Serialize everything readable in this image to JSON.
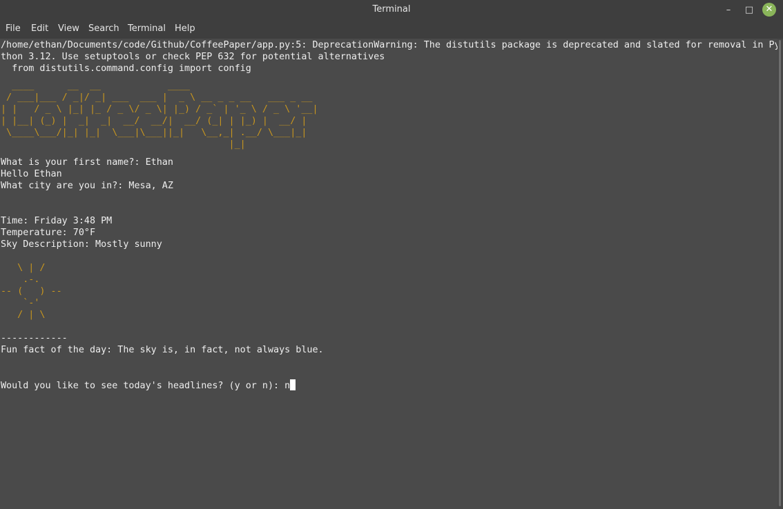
{
  "window": {
    "title": "Terminal",
    "controls": {
      "minimize": "–",
      "maximize": "□",
      "close": "✕"
    }
  },
  "menu": [
    "File",
    "Edit",
    "View",
    "Search",
    "Terminal",
    "Help"
  ],
  "terminal": {
    "warning": [
      "/home/ethan/Documents/code/Github/CoffeePaper/app.py:5: DeprecationWarning: The distutils package is deprecated and slated for removal in Py",
      "thon 3.12. Use setuptools or check PEP 632 for potential alternatives",
      "  from distutils.command.config import config"
    ],
    "banner_art": [
      "  ____      __  __            ____",
      " / ___|___ / _|/ _| ___  ___ |  _ \\ __ _ _ __   ___ _ __",
      "| |   / _ \\ |_| |_ / _ \\/ _ \\| |_) / _` | '_ \\ / _ \\ '__|",
      "| |__| (_) |  _|  _|  __/  __/|  __/ (_| | |_) |  __/ |",
      " \\____\\___/|_| |_|  \\___|\\___||_|   \\__,_| .__/ \\___|_|",
      "                                         |_|"
    ],
    "name_prompt": "What is your first name?: Ethan",
    "greeting": "Hello Ethan",
    "city_prompt": "What city are you in?: Mesa, AZ",
    "time": "Time: Friday 3:48 PM",
    "temperature": "Temperature: 70°F",
    "sky": "Sky Description: Mostly sunny",
    "sun_art": [
      "   \\ | /",
      "    .-.",
      "-- (   ) --",
      "    `-'",
      "   / | \\"
    ],
    "separator": "------------",
    "fun_fact": "Fun fact of the day: The sky is, in fact, not always blue.",
    "headlines_prompt": "Would you like to see today's headlines? (y or n): ",
    "typed_input": "n"
  },
  "colors": {
    "terminal_bg": "#4a4a4a",
    "titlebar_bg": "#3e3e3e",
    "text": "#eeeeee",
    "art": "#c8961e",
    "close_button": "#8ab55a"
  }
}
